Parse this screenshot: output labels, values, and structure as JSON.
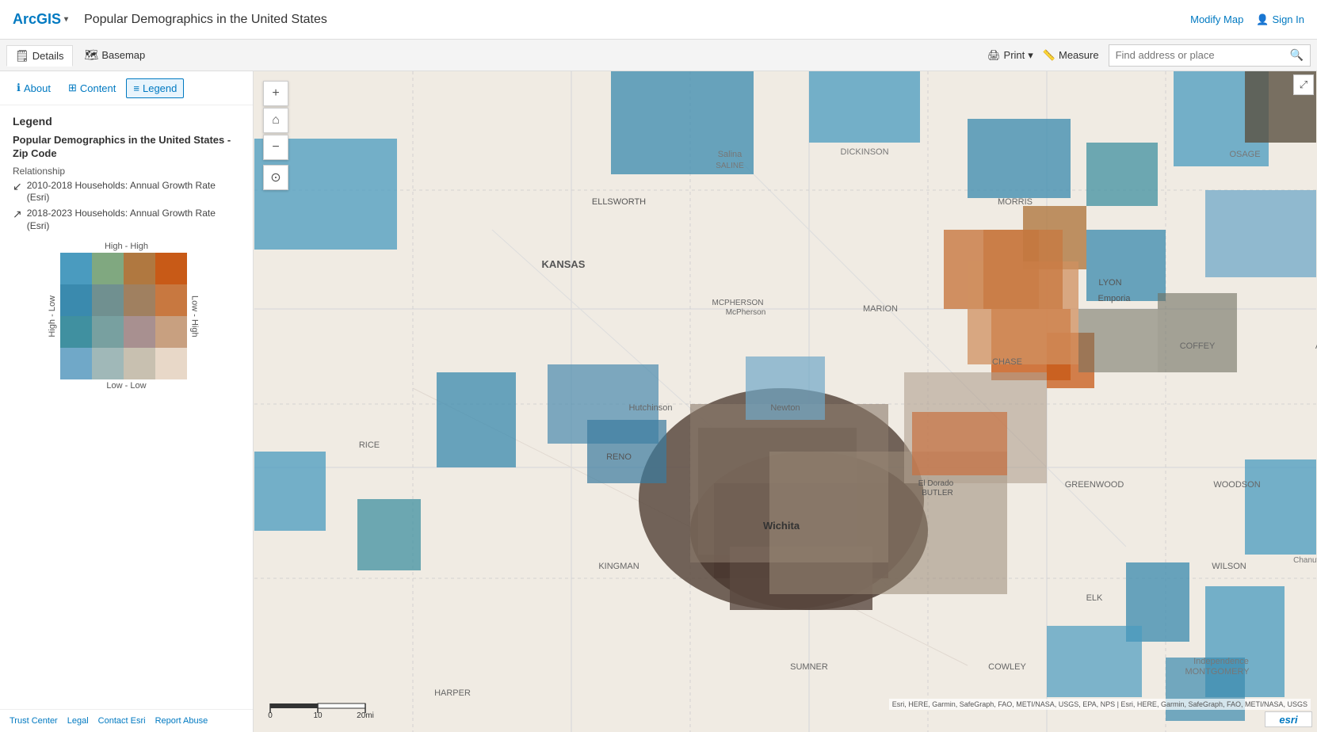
{
  "topbar": {
    "app_name": "ArcGIS",
    "map_title": "Popular Demographics in the United States",
    "modify_map": "Modify Map",
    "sign_in": "Sign In"
  },
  "toolbar": {
    "tabs": [
      {
        "id": "details",
        "label": "Details",
        "icon": "🗒",
        "active": true
      },
      {
        "id": "basemap",
        "label": "Basemap",
        "icon": "🗺",
        "active": false
      }
    ],
    "print_label": "Print",
    "measure_label": "Measure",
    "search_placeholder": "Find address or place"
  },
  "sidebar": {
    "tabs": [
      {
        "id": "about",
        "label": "About",
        "icon": "ℹ",
        "active": false
      },
      {
        "id": "content",
        "label": "Content",
        "icon": "⊞",
        "active": false
      },
      {
        "id": "legend",
        "label": "Legend",
        "icon": "≡",
        "active": true
      }
    ],
    "legend": {
      "title": "Legend",
      "layer_name": "Popular Demographics in the United States - Zip Code",
      "relationship_label": "Relationship",
      "items": [
        {
          "arrow": "↙",
          "text": "2010-2018 Households: Annual Growth Rate (Esri)"
        },
        {
          "arrow": "↗",
          "text": "2018-2023 Households: Annual Growth Rate (Esri)"
        }
      ],
      "grid_labels": {
        "top": "High - High",
        "left": "High - Low",
        "right": "Low - High",
        "bottom": "Low - Low"
      },
      "bivariate_colors": [
        [
          "#c85a17",
          "#b07840",
          "#80a880",
          "#4a9bbf"
        ],
        [
          "#c87840",
          "#a08060",
          "#709090",
          "#3a8aae"
        ],
        [
          "#c8a080",
          "#a89090",
          "#78a0a0",
          "#4090a0"
        ],
        [
          "#e8d8c8",
          "#c8c0b0",
          "#a0b8b8",
          "#70a8c8"
        ]
      ]
    }
  },
  "map": {
    "scale_labels": [
      "0",
      "10",
      "20mi"
    ],
    "attribution": "Esri, HERE, Garmin, SafeGraph, FAO, METI/NASA, USGS, EPA, NPS | Esri, HERE, Garmin, SafeGraph, FAO, METI/NASA, USGS",
    "esri_logo": "esri"
  },
  "footer": {
    "links": [
      "Trust Center",
      "Legal",
      "Contact Esri",
      "Report Abuse"
    ]
  }
}
